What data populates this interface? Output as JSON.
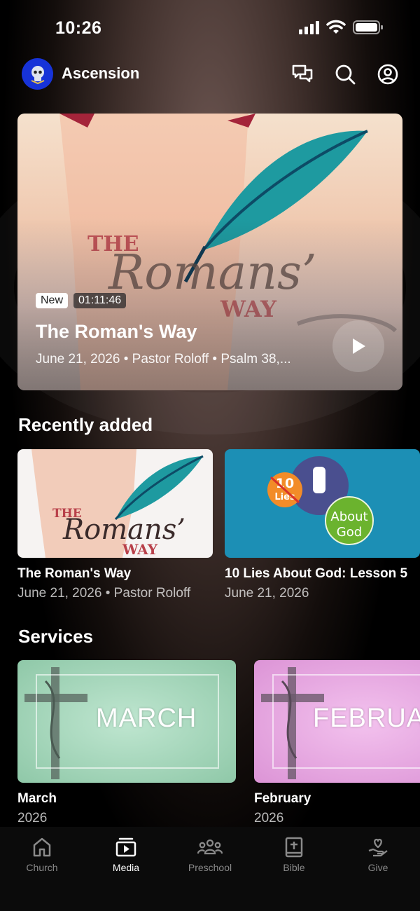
{
  "status_bar": {
    "time": "10:26"
  },
  "header": {
    "app_title": "Ascension"
  },
  "featured": {
    "badge_new": "New",
    "duration": "01:11:46",
    "title": "The Roman's Way",
    "meta": "June 21, 2026 • Pastor Roloff • Psalm 38,...",
    "art_text_the": "THE",
    "art_text_romans": "Romans’",
    "art_text_way": "WAY"
  },
  "recently_added": {
    "title": "Recently added",
    "items": [
      {
        "title": "The Roman's Way",
        "subtitle": "June 21, 2026 • Pastor Roloff"
      },
      {
        "title": "10 Lies About God: Lesson 5",
        "subtitle": "June 21, 2026",
        "art_number": "10",
        "art_lies": "Lies",
        "art_about": "About",
        "art_god": "God"
      }
    ]
  },
  "services": {
    "title": "Services",
    "items": [
      {
        "title": "March",
        "subtitle": "2026",
        "art_word": "MARCH",
        "color": "#a8d8bf"
      },
      {
        "title": "February",
        "subtitle": "2026",
        "art_word": "FEBRUARY",
        "color": "#e6a8e2"
      }
    ]
  },
  "bottom_nav": {
    "items": [
      {
        "label": "Church",
        "icon": "home-icon"
      },
      {
        "label": "Media",
        "icon": "media-icon",
        "active": true
      },
      {
        "label": "Preschool",
        "icon": "group-icon"
      },
      {
        "label": "Bible",
        "icon": "bible-icon"
      },
      {
        "label": "Give",
        "icon": "give-icon"
      }
    ]
  },
  "colors": {
    "brand_blue": "#1733d8",
    "background": "#000000",
    "teal_feather": "#1e9aa0"
  }
}
